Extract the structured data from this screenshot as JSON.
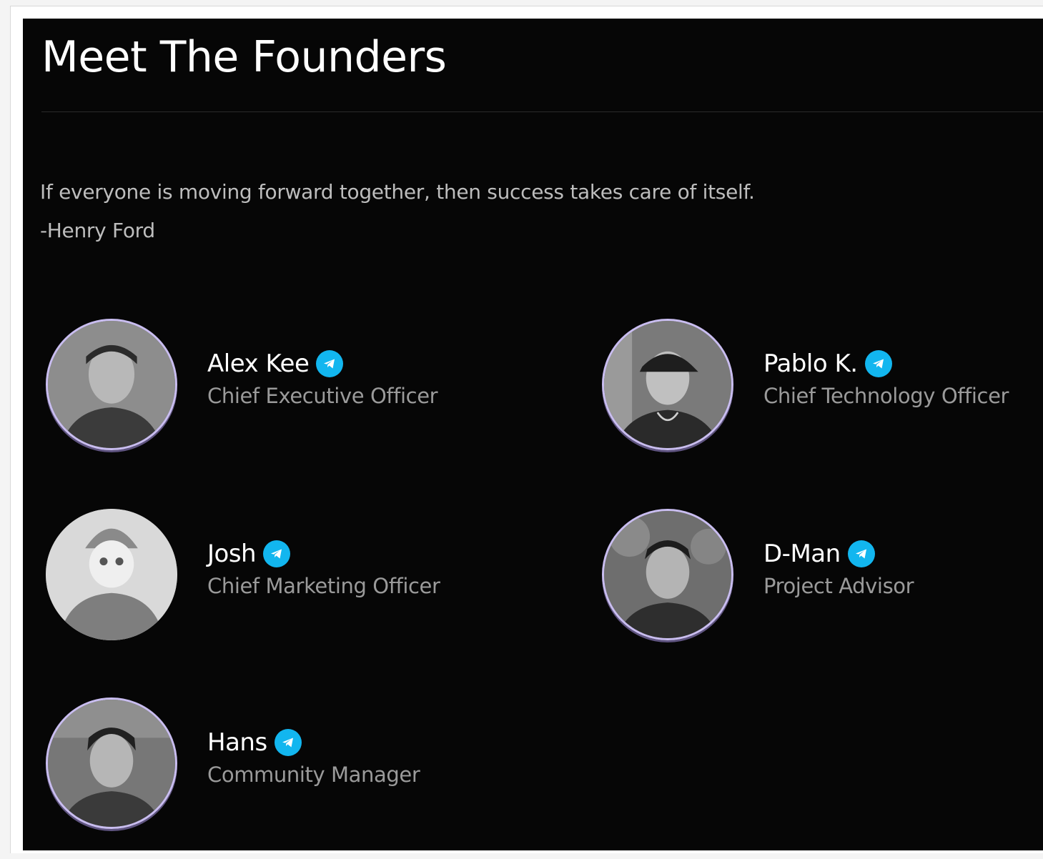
{
  "section": {
    "title": "Meet The Founders",
    "quote_text": "If everyone is moving forward together, then success takes care of itself.",
    "quote_author": "-Henry Ford"
  },
  "founders": [
    {
      "name": "Alex Kee",
      "role": "Chief Executive Officer",
      "icon": "telegram-icon"
    },
    {
      "name": "Pablo K.",
      "role": "Chief Technology Officer",
      "icon": "telegram-icon"
    },
    {
      "name": "Josh",
      "role": "Chief Marketing Officer",
      "icon": "telegram-icon"
    },
    {
      "name": "D-Man",
      "role": "Project Advisor",
      "icon": "telegram-icon"
    },
    {
      "name": "Hans",
      "role": "Community Manager",
      "icon": "telegram-icon"
    }
  ],
  "colors": {
    "background": "#060606",
    "telegram_accent": "#12b6ef",
    "avatar_ring": "#c9bdf0",
    "role_text": "#9a9a9a"
  }
}
